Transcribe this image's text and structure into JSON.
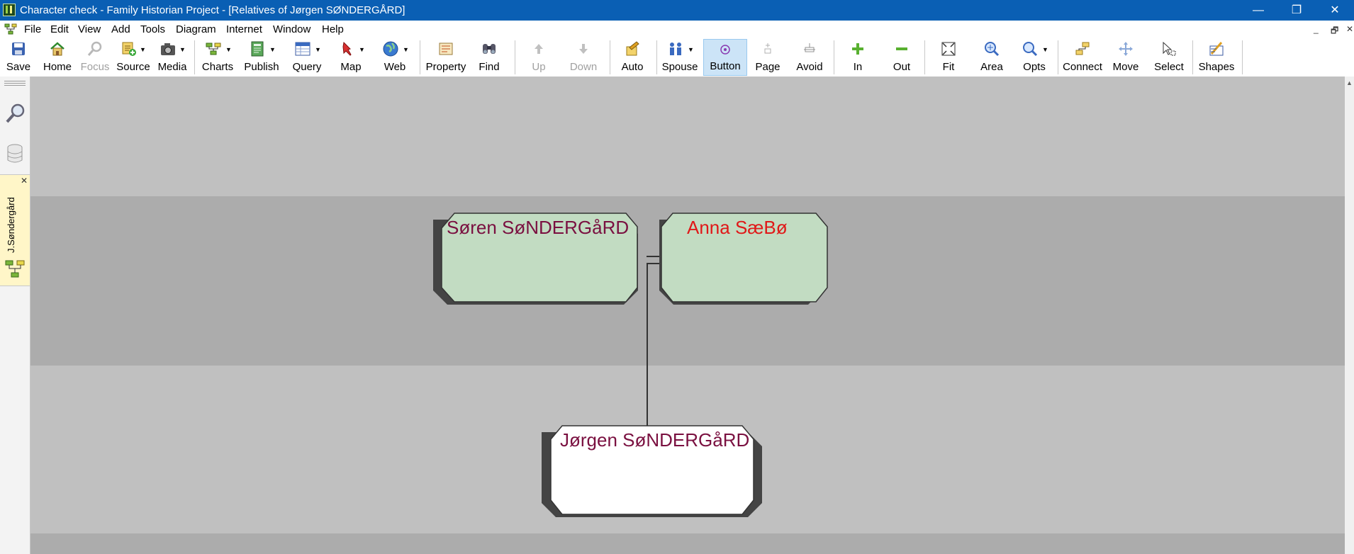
{
  "window": {
    "title": "Character check - Family Historian Project - [Relatives of Jørgen SØNDERGÅRD]"
  },
  "window_controls": {
    "minimize": "—",
    "restore": "❐",
    "close": "✕"
  },
  "menu": [
    "File",
    "Edit",
    "View",
    "Add",
    "Tools",
    "Diagram",
    "Internet",
    "Window",
    "Help"
  ],
  "mdi_controls": {
    "minimize": "_",
    "restore": "🗗",
    "close": "✕"
  },
  "toolbar": {
    "save": "Save",
    "home": "Home",
    "focus": "Focus",
    "source": "Source",
    "media": "Media",
    "charts": "Charts",
    "publish": "Publish",
    "query": "Query",
    "map": "Map",
    "web": "Web",
    "property": "Property",
    "find": "Find",
    "up": "Up",
    "down": "Down",
    "auto": "Auto",
    "spouse": "Spouse",
    "button": "Button",
    "page": "Page",
    "avoid": "Avoid",
    "in": "In",
    "out": "Out",
    "fit": "Fit",
    "area": "Area",
    "opts": "Opts",
    "connect": "Connect",
    "move": "Move",
    "select": "Select",
    "shapes": "Shapes"
  },
  "sidebar": {
    "tab_label": "J.Søndergård",
    "tab_close": "✕"
  },
  "diagram": {
    "people": {
      "father": "Søren SøNDERGåRD",
      "mother": "Anna SæBø",
      "child": "Jørgen SøNDERGåRD"
    }
  },
  "colors": {
    "titlebar": "#0a5fb4",
    "name_male": "#7a1040",
    "name_female": "#e01818",
    "box_parent_fill": "#c2dcc2",
    "box_child_fill": "#ffffff",
    "band_dark": "#acacac",
    "band_light": "#c0c0c0"
  },
  "scrollbar": {
    "up_arrow": "▲"
  }
}
